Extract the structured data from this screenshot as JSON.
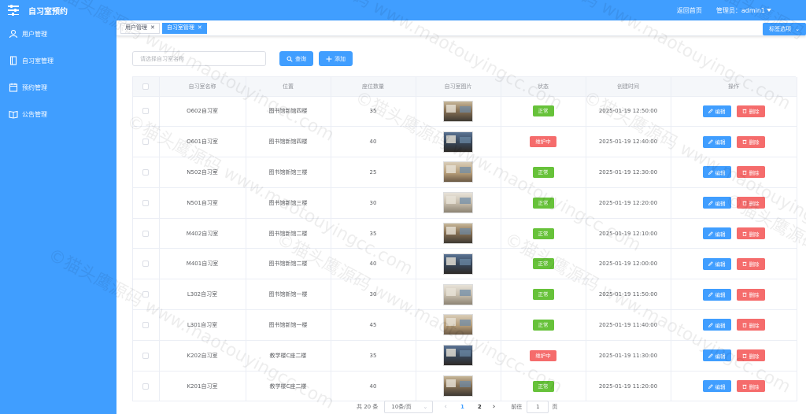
{
  "app": {
    "title": "自习室预约"
  },
  "header": {
    "home_link": "返回首页",
    "admin_label": "管理员：admin1"
  },
  "sidebar": {
    "items": [
      {
        "label": "用户管理",
        "icon": "user-icon"
      },
      {
        "label": "自习室管理",
        "icon": "book-icon"
      },
      {
        "label": "预约管理",
        "icon": "calendar-icon"
      },
      {
        "label": "公告管理",
        "icon": "open-book-icon"
      }
    ]
  },
  "tabs": [
    {
      "label": "用户管理",
      "active": false
    },
    {
      "label": "自习室管理",
      "active": true
    }
  ],
  "tag_options_label": "标签选项",
  "search": {
    "placeholder": "请选择自习室名称",
    "value": ""
  },
  "buttons": {
    "query": "查询",
    "add": "添加",
    "edit": "编辑",
    "delete": "删除"
  },
  "table": {
    "columns": [
      "",
      "自习室名称",
      "位置",
      "座位数量",
      "自习室图片",
      "状态",
      "创建时间",
      "操作"
    ],
    "rows": [
      {
        "name": "O602自习室",
        "location": "图书馆新馆四楼",
        "seats": "35",
        "status": "正常",
        "status_type": "ok",
        "created": "2025-01-19 12:50:00"
      },
      {
        "name": "O601自习室",
        "location": "图书馆新馆四楼",
        "seats": "40",
        "status": "维护中",
        "status_type": "fix",
        "created": "2025-01-19 12:40:00"
      },
      {
        "name": "N502自习室",
        "location": "图书馆新馆三楼",
        "seats": "25",
        "status": "正常",
        "status_type": "ok",
        "created": "2025-01-19 12:30:00"
      },
      {
        "name": "N501自习室",
        "location": "图书馆新馆三楼",
        "seats": "30",
        "status": "正常",
        "status_type": "ok",
        "created": "2025-01-19 12:20:00"
      },
      {
        "name": "M402自习室",
        "location": "图书馆新馆二楼",
        "seats": "35",
        "status": "正常",
        "status_type": "ok",
        "created": "2025-01-19 12:10:00"
      },
      {
        "name": "M401自习室",
        "location": "图书馆新馆二楼",
        "seats": "40",
        "status": "正常",
        "status_type": "ok",
        "created": "2025-01-19 12:00:00"
      },
      {
        "name": "L302自习室",
        "location": "图书馆新馆一楼",
        "seats": "30",
        "status": "正常",
        "status_type": "ok",
        "created": "2025-01-19 11:50:00"
      },
      {
        "name": "L301自习室",
        "location": "图书馆新馆一楼",
        "seats": "45",
        "status": "正常",
        "status_type": "ok",
        "created": "2025-01-19 11:40:00"
      },
      {
        "name": "K202自习室",
        "location": "教学楼C座二楼",
        "seats": "35",
        "status": "维护中",
        "status_type": "fix",
        "created": "2025-01-19 11:30:00"
      },
      {
        "name": "K201自习室",
        "location": "教学楼C座二楼",
        "seats": "40",
        "status": "正常",
        "status_type": "ok",
        "created": "2025-01-19 11:20:00"
      }
    ]
  },
  "pagination": {
    "total_label": "共 20 条",
    "page_size": "10条/页",
    "pages": [
      "1",
      "2"
    ],
    "current_page": "1",
    "goto_prefix": "前往",
    "goto_value": "1",
    "goto_suffix": "页"
  },
  "watermark": "©猫头鹰源码 www.maotouyingcc.com",
  "colors": {
    "primary": "#409eff",
    "success": "#67c23a",
    "danger": "#f56c6c"
  }
}
